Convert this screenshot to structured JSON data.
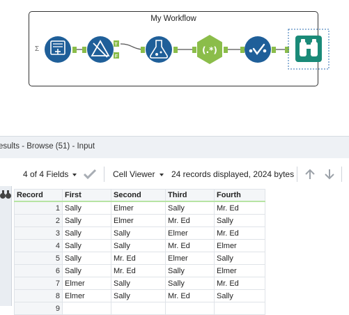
{
  "workflow": {
    "title": "My Workflow"
  },
  "results": {
    "title": "esults - Browse (51) - Input"
  },
  "toolbar": {
    "fields_label": "4 of 4 Fields",
    "cell_viewer_label": "Cell Viewer",
    "records_info": "24 records displayed, 2024 bytes"
  },
  "colors": {
    "tool_blue": "#1f5f99",
    "tool_green": "#8bbd4a",
    "tool_teal": "#1a8a78",
    "header_underline": "#b7e4a3"
  },
  "icons": [
    "list-icon",
    "binoculars-icon",
    "checkmark-icon",
    "up-arrow-icon",
    "down-arrow-icon"
  ],
  "table": {
    "columns": [
      "Record",
      "First",
      "Second",
      "Third",
      "Fourth"
    ],
    "rows": [
      [
        "1",
        "Sally",
        "Elmer",
        "Sally",
        "Mr. Ed"
      ],
      [
        "2",
        "Sally",
        "Elmer",
        "Mr. Ed",
        "Sally"
      ],
      [
        "3",
        "Sally",
        "Sally",
        "Elmer",
        "Mr. Ed"
      ],
      [
        "4",
        "Sally",
        "Sally",
        "Mr. Ed",
        "Elmer"
      ],
      [
        "5",
        "Sally",
        "Mr. Ed",
        "Elmer",
        "Sally"
      ],
      [
        "6",
        "Sally",
        "Mr. Ed",
        "Sally",
        "Elmer"
      ],
      [
        "7",
        "Elmer",
        "Sally",
        "Sally",
        "Mr. Ed"
      ],
      [
        "8",
        "Elmer",
        "Sally",
        "Mr. Ed",
        "Sally"
      ],
      [
        "9",
        "",
        "",
        "",
        ""
      ]
    ]
  }
}
